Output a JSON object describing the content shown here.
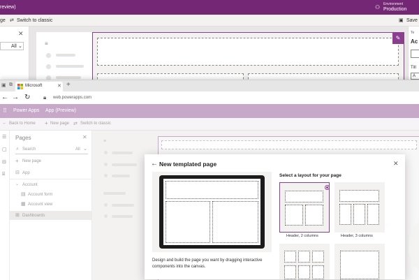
{
  "back_window": {
    "title_suffix": "review)",
    "environment_label": "Environment",
    "environment_value": "Production",
    "cmd_left": "ge",
    "switch_classic": "Switch to classic",
    "save": "Save",
    "filter_value": "All",
    "right_panel_label1": "Te",
    "right_panel_label2": "Ac",
    "right_panel_label3": "Titl",
    "right_panel_label4": "A"
  },
  "browser": {
    "tab_title": "Microsoft",
    "new_tab": "+",
    "url": "web.powerapps.com"
  },
  "powerapps": {
    "brand": "Power Apps",
    "app_name": "App (Preview)",
    "back_to_home": "Back to Home",
    "new_page": "New page",
    "switch_classic": "Switch to classic"
  },
  "pages_panel": {
    "title": "Pages",
    "search_placeholder": "Search",
    "filter": "All",
    "new_page": "New page",
    "items": [
      {
        "label": "App",
        "indent": 0
      },
      {
        "label": "Account",
        "indent": 0
      },
      {
        "label": "Account form",
        "indent": 1
      },
      {
        "label": "Account view",
        "indent": 1
      },
      {
        "label": "Dashboards",
        "indent": 0
      }
    ]
  },
  "dialog": {
    "title": "New templated page",
    "layout_prompt": "Select a layout for your page",
    "description": "Design and build the page you want by dragging interactive components into the canvas.",
    "layouts": [
      {
        "label": "Header, 2 columns",
        "selected": true
      },
      {
        "label": "Header, 3 columns",
        "selected": false
      }
    ]
  }
}
